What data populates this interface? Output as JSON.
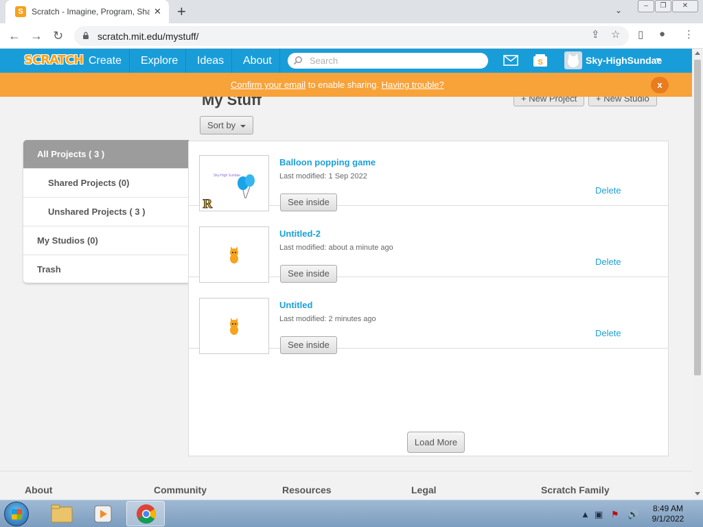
{
  "browser": {
    "tab_title": "Scratch - Imagine, Program, Share",
    "tab_favicon": "S",
    "new_tab_label": "+",
    "url": "scratch.mit.edu/mystuff/"
  },
  "nav": {
    "logo": "SCRATCH",
    "links": [
      "Create",
      "Explore",
      "Ideas",
      "About"
    ],
    "search_placeholder": "Search",
    "username": "Sky-HighSundae",
    "colors": {
      "nav": "#199dd9",
      "banner": "#f8a23a"
    }
  },
  "banner": {
    "confirm_link": "Confirm your email",
    "middle_text": " to enable sharing. ",
    "trouble_link": "Having trouble?",
    "close": "x"
  },
  "main": {
    "title": "My Stuff",
    "new_project": "+ New Project",
    "new_studio": "+ New Studio",
    "sort_by": "Sort by"
  },
  "sidebar": {
    "items": [
      {
        "label": "All Projects ( 3 )"
      },
      {
        "label": "Shared Projects (0)"
      },
      {
        "label": "Unshared Projects ( 3 )"
      },
      {
        "label": "My Studios (0)"
      },
      {
        "label": "Trash"
      }
    ]
  },
  "projects": [
    {
      "title": "Balloon popping game",
      "meta": "Last modified: 1 Sep 2022",
      "see_inside": "See inside",
      "delete": "Delete",
      "thumb_caption": "Sky-High Sundae",
      "thumb_icon": "balloons"
    },
    {
      "title": "Untitled-2",
      "meta": "Last modified: about a minute ago",
      "see_inside": "See inside",
      "delete": "Delete",
      "thumb_icon": "scratch-cat"
    },
    {
      "title": "Untitled",
      "meta": "Last modified: 2 minutes ago",
      "see_inside": "See inside",
      "delete": "Delete",
      "thumb_icon": "scratch-cat"
    }
  ],
  "load_more": "Load More",
  "footer": {
    "columns": [
      "About",
      "Community",
      "Resources",
      "Legal",
      "Scratch Family"
    ]
  },
  "taskbar": {
    "time": "8:49 AM",
    "date": "9/1/2022"
  }
}
